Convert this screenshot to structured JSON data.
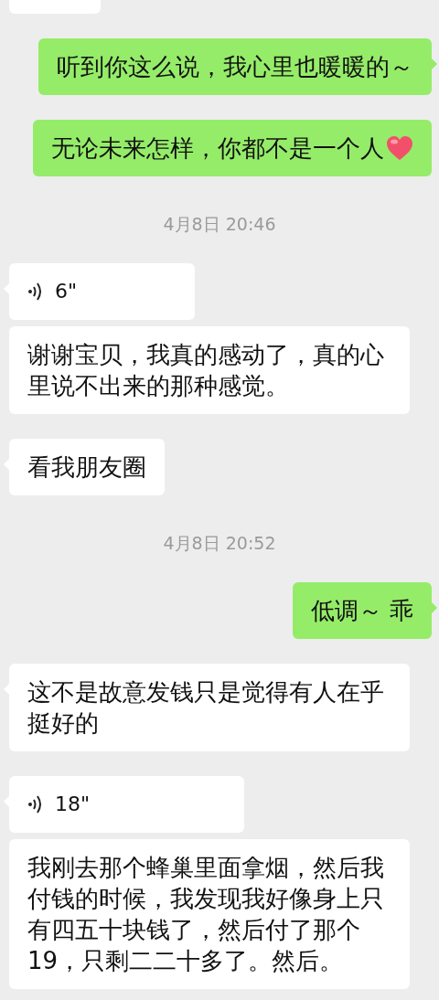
{
  "messages": [
    {
      "kind": "partial"
    },
    {
      "kind": "text",
      "sent_by_me": true,
      "tail": true,
      "text": "听到你这么说，我心里也暖暖的～"
    },
    {
      "kind": "text",
      "sent_by_me": true,
      "tail": false,
      "text": "无论未来怎样，你都不是一个人",
      "heart_emoji": true
    },
    {
      "kind": "time",
      "text": "4月8日 20:46"
    },
    {
      "kind": "voice",
      "sent_by_me": false,
      "tail": true,
      "duration": "6\""
    },
    {
      "kind": "text",
      "sent_by_me": false,
      "tail": false,
      "text": "谢谢宝贝，我真的感动了，真的心里说不出来的那种感觉。"
    },
    {
      "kind": "text",
      "sent_by_me": false,
      "tail": true,
      "text": "看我朋友圈"
    },
    {
      "kind": "time",
      "text": "4月8日 20:52"
    },
    {
      "kind": "text",
      "sent_by_me": true,
      "tail": true,
      "text": "低调～ 乖"
    },
    {
      "kind": "text",
      "sent_by_me": false,
      "tail": true,
      "text": "这不是故意发钱只是觉得有人在乎挺好的"
    },
    {
      "kind": "voice",
      "sent_by_me": false,
      "tail": true,
      "duration": "18\""
    },
    {
      "kind": "text",
      "sent_by_me": false,
      "tail": false,
      "text": "我刚去那个蜂巢里面拿烟，然后我付钱的时候，我发现我好像身上只有四五十块钱了，然后付了那个19，只剩二二十多了。然后。"
    }
  ]
}
